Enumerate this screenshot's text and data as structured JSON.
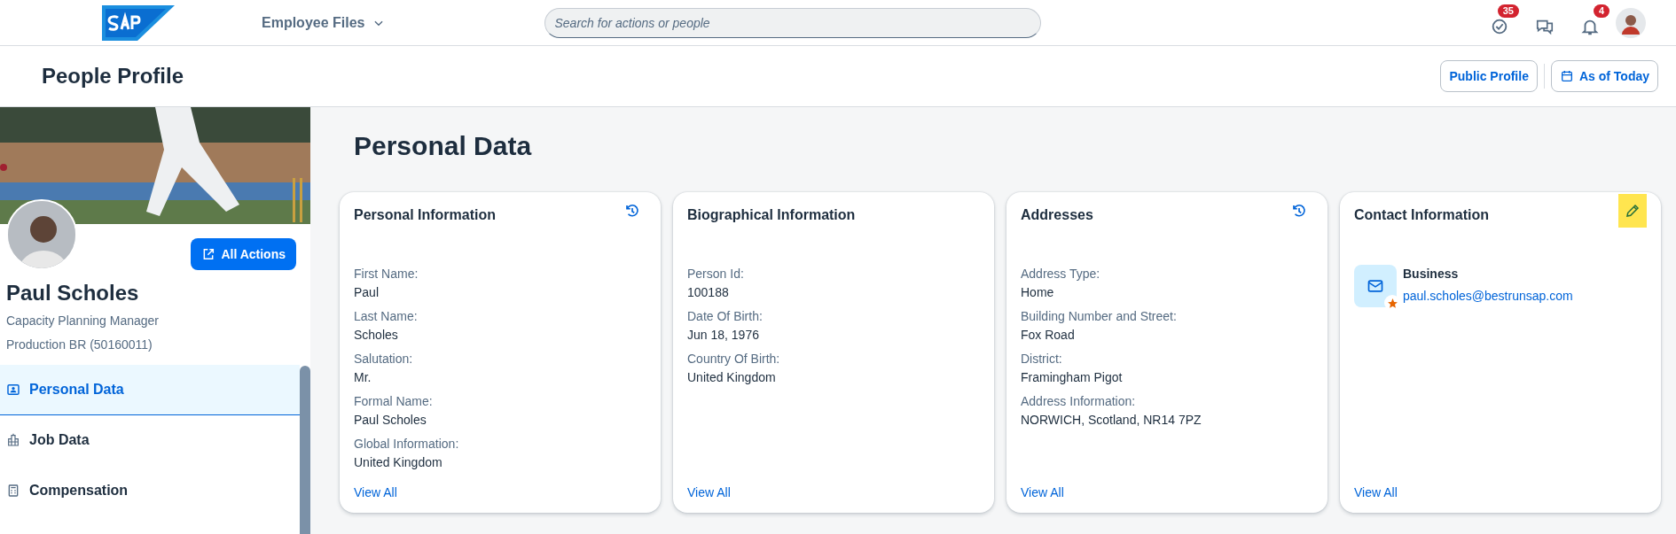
{
  "shell": {
    "product_menu": "Employee Files",
    "search": {
      "placeholder": "Search for actions or people"
    },
    "actions": [
      {
        "kind": "tasks",
        "badge": "35"
      },
      {
        "kind": "help"
      },
      {
        "kind": "bell",
        "badge": "4"
      }
    ]
  },
  "page_header": {
    "title": "People Profile",
    "buttons": [
      {
        "kind": "plain",
        "label": "Public Profile"
      },
      {
        "kind": "calendar",
        "label": "As of Today"
      }
    ]
  },
  "profile": {
    "name": "Paul Scholes",
    "job_title": "Capacity Planning Manager",
    "org": "Production BR (50160011)",
    "action_button": "All Actions"
  },
  "nav": [
    {
      "kind": "person",
      "label": "Personal Data",
      "selected": true
    },
    {
      "kind": "building",
      "label": "Job Data",
      "selected": false
    },
    {
      "kind": "calculator",
      "label": "Compensation",
      "selected": false
    }
  ],
  "section_title": "Personal Data",
  "cards": [
    {
      "title": "Personal Information",
      "action": {
        "kind": "history",
        "highlighted": false
      },
      "fields": [
        {
          "label": "First Name:",
          "value": "Paul"
        },
        {
          "label": "Last Name:",
          "value": "Scholes"
        },
        {
          "label": "Salutation:",
          "value": "Mr."
        },
        {
          "label": "Formal Name:",
          "value": "Paul Scholes"
        },
        {
          "label": "Global Information:",
          "value": "United Kingdom"
        }
      ],
      "link": "View All"
    },
    {
      "title": "Biographical Information",
      "fields": [
        {
          "label": "Person Id:",
          "value": "100188"
        },
        {
          "label": "Date Of Birth:",
          "value": "Jun 18, 1976"
        },
        {
          "label": "Country Of Birth:",
          "value": "United Kingdom"
        }
      ],
      "link": "View All"
    },
    {
      "title": "Addresses",
      "action": {
        "kind": "history",
        "highlighted": false
      },
      "fields": [
        {
          "label": "Address Type:",
          "value": "Home"
        },
        {
          "label": "Building Number and Street:",
          "value": "Fox Road"
        },
        {
          "label": "District:",
          "value": "Framingham Pigot"
        },
        {
          "label": "Address Information:",
          "value": "NORWICH, Scotland, NR14 7PZ"
        }
      ],
      "link": "View All"
    },
    {
      "title": "Contact Information",
      "action": {
        "kind": "edit",
        "highlighted": true
      },
      "contacts": [
        {
          "type": "Business",
          "email": "paul.scholes@bestrunsap.com",
          "favorite": true
        }
      ],
      "link": "View All"
    }
  ]
}
